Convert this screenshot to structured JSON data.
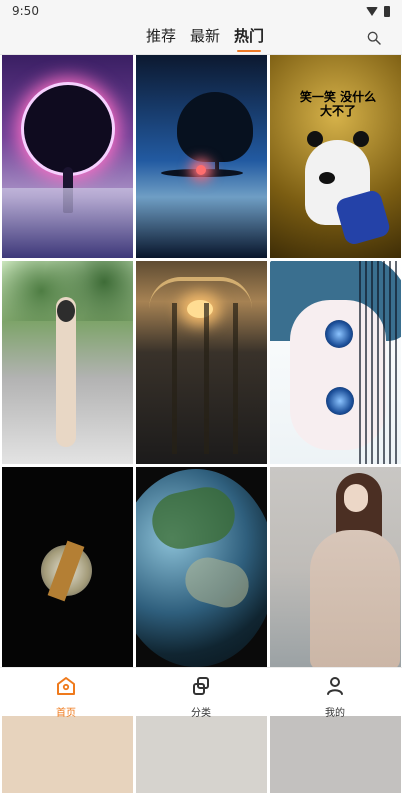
{
  "status": {
    "time": "9:50"
  },
  "top_tabs": {
    "tabs": [
      {
        "label": "推荐"
      },
      {
        "label": "最新"
      },
      {
        "label": "热门"
      }
    ],
    "active_index": 2
  },
  "thumbnail_text": {
    "panda_text": "笑一笑 没什么大不了"
  },
  "bottom_nav": {
    "items": [
      {
        "label": "首页"
      },
      {
        "label": "分类"
      },
      {
        "label": "我的"
      }
    ],
    "active_color": "#ef7a1c"
  },
  "icons": {
    "search": "search-icon",
    "wifi": "wifi-icon",
    "battery": "battery-icon",
    "home": "home-icon",
    "category": "category-icon",
    "mine": "user-icon"
  }
}
